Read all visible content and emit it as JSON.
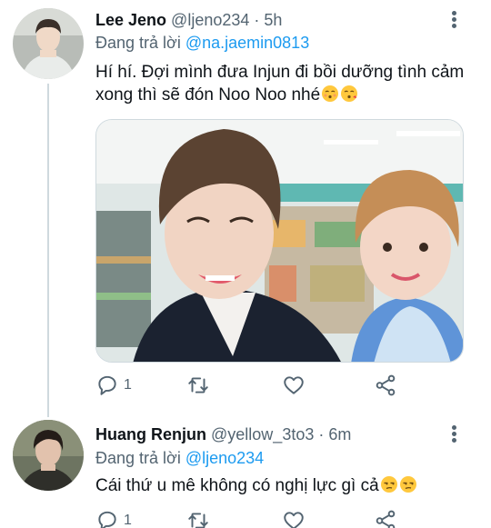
{
  "tweets": [
    {
      "name": "Lee Jeno",
      "handle": "@ljeno234",
      "separator": "·",
      "time": "5h",
      "reply_prefix": "Đang trả lời ",
      "reply_mention": "@na.jaemin0813",
      "text": "Hí hí. Đợi mình đưa Injun đi bồi dưỡng tình cảm xong thì sẽ đón Noo Noo nhé",
      "emojis": [
        "kissing-face-emoji",
        "kissing-face-emoji"
      ],
      "reply_count": "1"
    },
    {
      "name": "Huang Renjun",
      "handle": "@yellow_3to3",
      "separator": "·",
      "time": "6m",
      "reply_prefix": "Đang trả lời ",
      "reply_mention": "@ljeno234",
      "text": "Cái thứ u mê không có nghị lực gì cả",
      "emojis": [
        "unamused-face-emoji",
        "unamused-face-emoji"
      ],
      "reply_count": "1"
    }
  ],
  "icons": {
    "reply": "reply-icon",
    "retweet": "retweet-icon",
    "like": "heart-icon",
    "share": "share-icon",
    "more": "more-vertical-icon"
  },
  "colors": {
    "link": "#1d9bf0",
    "secondary_text": "#536471",
    "primary_text": "#0f1419",
    "thread_line": "#cfd9de"
  }
}
